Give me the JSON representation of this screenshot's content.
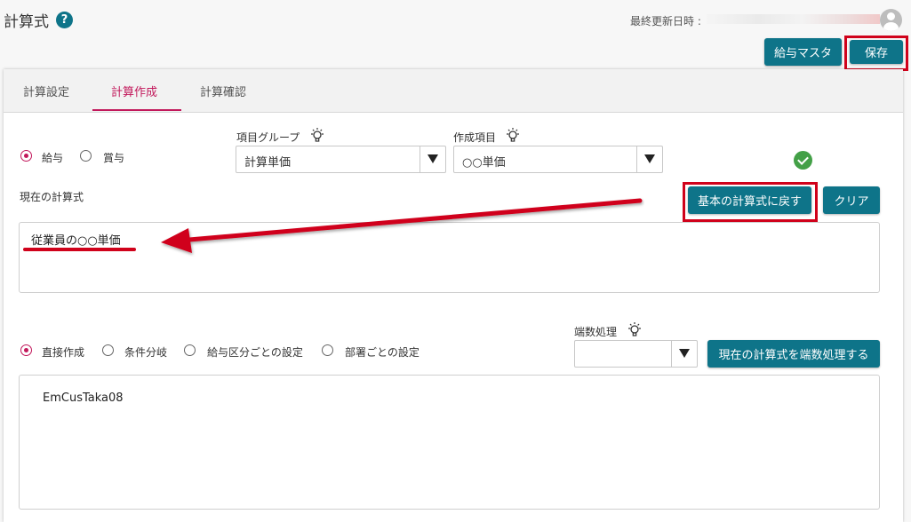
{
  "header": {
    "title": "計算式",
    "help_icon": "?",
    "last_updated_label": "最終更新日時 :"
  },
  "toolbar": {
    "salary_master_label": "給与マスタ",
    "save_label": "保存"
  },
  "tabs": [
    {
      "label": "計算設定",
      "active": false
    },
    {
      "label": "計算作成",
      "active": true
    },
    {
      "label": "計算確認",
      "active": false
    }
  ],
  "pay_type": {
    "options": [
      "給与",
      "賞与"
    ],
    "selected": "給与"
  },
  "item_group": {
    "label": "項目グループ",
    "value": "計算単価"
  },
  "created_item": {
    "label": "作成項目",
    "value": "○○単価"
  },
  "current_formula": {
    "label": "現在の計算式",
    "reset_label": "基本の計算式に戻す",
    "clear_label": "クリア",
    "value": "従業員の○○単価"
  },
  "creation_method": {
    "options": [
      "直接作成",
      "条件分岐",
      "給与区分ごとの設定",
      "部署ごとの設定"
    ],
    "selected": "直接作成"
  },
  "rounding": {
    "label": "端数処理",
    "value": "",
    "apply_label": "現在の計算式を端数処理する"
  },
  "editor": {
    "value": "EmCusTaka08"
  },
  "colors": {
    "accent": "#0e7489",
    "active_tab": "#c2185b",
    "annotation": "#d0021b",
    "success": "#43a047"
  }
}
